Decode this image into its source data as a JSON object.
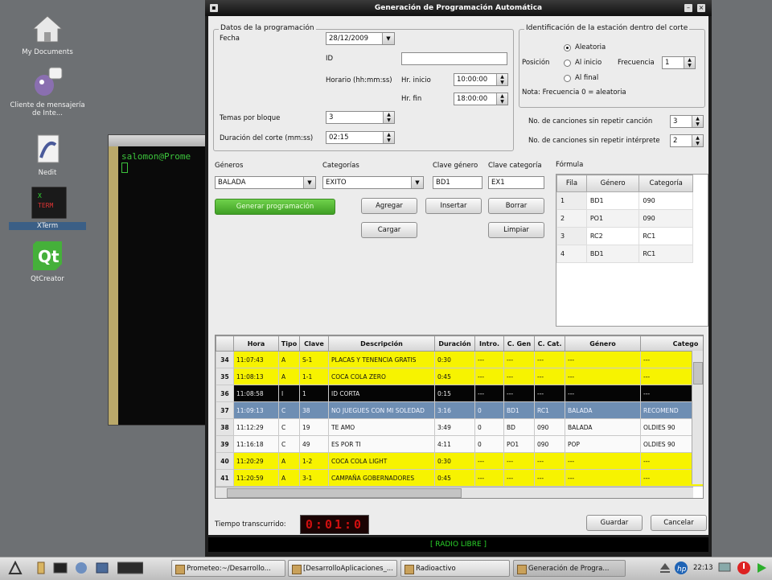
{
  "desktop": {
    "icons": [
      {
        "label": "My Documents"
      },
      {
        "label": "Cliente de mensajería de Inte..."
      },
      {
        "label": "Nedit"
      },
      {
        "label": "XTerm"
      },
      {
        "label": "QtCreator"
      }
    ],
    "terminal_prompt": "salomon@Prome"
  },
  "window": {
    "title": "Generación de Programación Automática",
    "datos": {
      "title": "Datos de la programación",
      "fecha_label": "Fecha",
      "fecha_value": "28/12/2009",
      "id_label": "ID",
      "id_value": "",
      "horario_label": "Horario (hh:mm:ss)",
      "hr_inicio_label": "Hr. inicio",
      "hr_inicio_value": "10:00:00",
      "hr_fin_label": "Hr. fin",
      "hr_fin_value": "18:00:00",
      "temas_label": "Temas por bloque",
      "temas_value": "3",
      "duracion_label": "Duración del corte (mm:ss)",
      "duracion_value": "02:15"
    },
    "identificacion": {
      "title": "Identificación de la estación dentro del corte",
      "posicion_label": "Posición",
      "options": [
        "Aleatoria",
        "Al inicio",
        "Al final"
      ],
      "selected": "Aleatoria",
      "frecuencia_label": "Frecuencia",
      "frecuencia_value": "1",
      "nota": "Nota: Frecuencia 0 = aleatoria"
    },
    "sin_repetir_cancion_label": "No. de canciones sin repetir canción",
    "sin_repetir_cancion_value": "3",
    "sin_repetir_interprete_label": "No. de canciones sin repetir intérprete",
    "sin_repetir_interprete_value": "2",
    "generos_label": "Géneros",
    "generos_value": "BALADA",
    "categorias_label": "Categorías",
    "categorias_value": "EXITO",
    "clave_genero_label": "Clave género",
    "clave_genero_value": "BD1",
    "clave_categoria_label": "Clave categoría",
    "clave_categoria_value": "EX1",
    "buttons": {
      "generar": "Generar programación",
      "agregar": "Agregar",
      "insertar": "Insertar",
      "borrar": "Borrar",
      "cargar": "Cargar",
      "limpiar": "Limpiar",
      "guardar": "Guardar",
      "cancelar": "Cancelar"
    },
    "formula": {
      "title": "Fórmula",
      "headers": [
        "Fila",
        "Género",
        "Categoría"
      ],
      "rows": [
        {
          "fila": "1",
          "genero": "BD1",
          "categoria": "090"
        },
        {
          "fila": "2",
          "genero": "PO1",
          "categoria": "090"
        },
        {
          "fila": "3",
          "genero": "RC2",
          "categoria": "RC1"
        },
        {
          "fila": "4",
          "genero": "BD1",
          "categoria": "RC1"
        }
      ]
    },
    "programacion": {
      "headers": [
        "",
        "Hora",
        "Tipo",
        "Clave",
        "Descripción",
        "Duración",
        "Intro.",
        "C. Gen",
        "C. Cat.",
        "Género",
        "Catego"
      ],
      "rows": [
        {
          "n": "34",
          "hora": "11:07:43",
          "tipo": "A",
          "clave": "S-1",
          "desc": "PLACAS Y TENENCIA GRATIS",
          "dur": "0:30",
          "intro": "---",
          "cgen": "---",
          "ccat": "---",
          "genero": "---",
          "cat": "---",
          "style": "yellow"
        },
        {
          "n": "35",
          "hora": "11:08:13",
          "tipo": "A",
          "clave": "1-1",
          "desc": "COCA COLA ZERO",
          "dur": "0:45",
          "intro": "---",
          "cgen": "---",
          "ccat": "---",
          "genero": "---",
          "cat": "---",
          "style": "yellow"
        },
        {
          "n": "36",
          "hora": "11:08:58",
          "tipo": "I",
          "clave": "1",
          "desc": "ID CORTA",
          "dur": "0:15",
          "intro": "---",
          "cgen": "---",
          "ccat": "---",
          "genero": "---",
          "cat": "---",
          "style": "black"
        },
        {
          "n": "37",
          "hora": "11:09:13",
          "tipo": "C",
          "clave": "38",
          "desc": "NO JUEGUES CON MI SOLEDAD",
          "dur": "3:16",
          "intro": "0",
          "cgen": "BD1",
          "ccat": "RC1",
          "genero": "BALADA",
          "cat": "RECOMEND",
          "style": "blue"
        },
        {
          "n": "38",
          "hora": "11:12:29",
          "tipo": "C",
          "clave": "19",
          "desc": "TE AMO",
          "dur": "3:49",
          "intro": "0",
          "cgen": "BD",
          "ccat": "090",
          "genero": "BALADA",
          "cat": "OLDIES 90",
          "style": "white"
        },
        {
          "n": "39",
          "hora": "11:16:18",
          "tipo": "C",
          "clave": "49",
          "desc": "ES POR TI",
          "dur": "4:11",
          "intro": "0",
          "cgen": "PO1",
          "ccat": "090",
          "genero": "POP",
          "cat": "OLDIES 90",
          "style": "white"
        },
        {
          "n": "40",
          "hora": "11:20:29",
          "tipo": "A",
          "clave": "1-2",
          "desc": "COCA COLA LIGHT",
          "dur": "0:30",
          "intro": "---",
          "cgen": "---",
          "ccat": "---",
          "genero": "---",
          "cat": "---",
          "style": "yellow"
        },
        {
          "n": "41",
          "hora": "11:20:59",
          "tipo": "A",
          "clave": "3-1",
          "desc": "CAMPAÑA GOBERNADORES",
          "dur": "0:45",
          "intro": "---",
          "cgen": "---",
          "ccat": "---",
          "genero": "---",
          "cat": "---",
          "style": "yellow"
        }
      ]
    },
    "tiempo_label": "Tiempo transcurrido:",
    "tiempo_value": "0:01:0",
    "status": "[ RADIO LIBRE ]"
  },
  "taskbar": {
    "tasks": [
      {
        "label": "Prometeo:~/Desarrollo..."
      },
      {
        "label": "[DesarrolloAplicaciones_..."
      },
      {
        "label": "Radioactivo"
      },
      {
        "label": "Generación de Progra..."
      }
    ],
    "clock": "22:13"
  }
}
